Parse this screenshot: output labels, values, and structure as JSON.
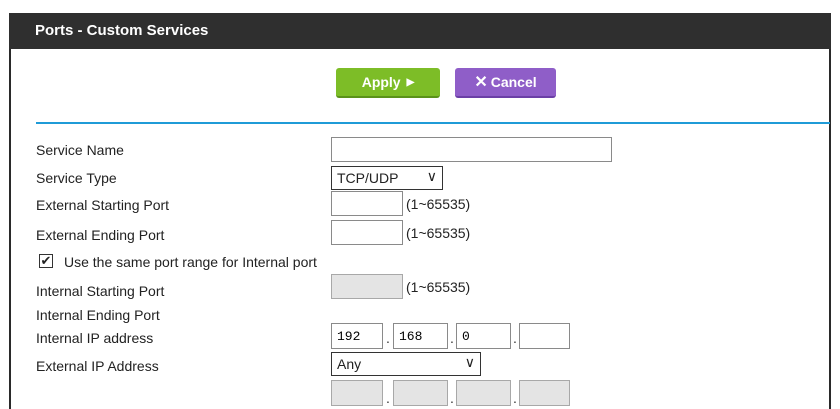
{
  "header": {
    "title": "Ports - Custom Services"
  },
  "toolbar": {
    "apply_label": "Apply",
    "cancel_label": "Cancel"
  },
  "form": {
    "service_name": {
      "label": "Service Name",
      "value": ""
    },
    "service_type": {
      "label": "Service Type",
      "value": "TCP/UDP"
    },
    "ext_start": {
      "label": "External Starting Port",
      "value": "",
      "hint": "(1~65535)"
    },
    "ext_end": {
      "label": "External Ending Port",
      "value": "",
      "hint": "(1~65535)"
    },
    "same_range": {
      "label": "Use the same port range for Internal port",
      "checked": true
    },
    "int_start": {
      "label": "Internal Starting Port",
      "value": "",
      "hint": "(1~65535)"
    },
    "int_end": {
      "label": "Internal Ending Port"
    },
    "internal_ip": {
      "label": "Internal IP address",
      "octets": [
        "192",
        "168",
        "0",
        ""
      ]
    },
    "external_ip": {
      "label": "External IP Address",
      "value": "Any",
      "octets": [
        "",
        "",
        "",
        ""
      ]
    }
  },
  "colors": {
    "apply": "#7dbd27",
    "cancel": "#8f5ec8",
    "rule": "#1f9bd7",
    "titlebar": "#2f2f2f"
  },
  "icons": {
    "apply": "play-arrow-icon",
    "cancel": "x-icon",
    "select": "chevron-down-icon",
    "check": "checkmark-icon"
  }
}
